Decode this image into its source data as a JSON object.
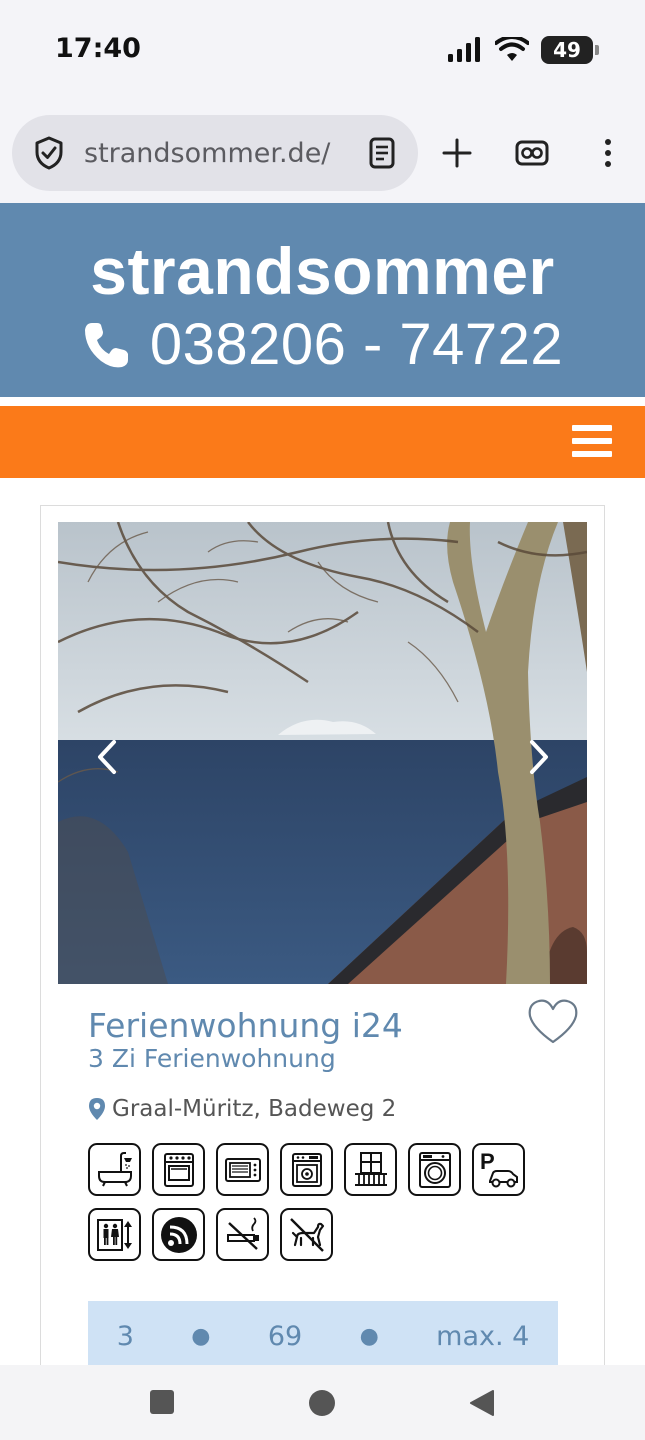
{
  "status_bar": {
    "time": "17:40",
    "battery": "49"
  },
  "browser": {
    "url": "strandsommer.de/"
  },
  "header": {
    "brand": "strandsommer",
    "phone": "038206 - 74722"
  },
  "listing": {
    "title": "Ferienwohnung i24",
    "subtitle": "3 Zi Ferienwohnung",
    "address": "Graal-Müritz, Badeweg 2",
    "amenities": [
      "bathtub-shower",
      "stove",
      "microwave",
      "dishwasher",
      "balcony",
      "washing-machine",
      "parking",
      "elevator",
      "wifi",
      "no-smoking",
      "no-pets"
    ],
    "facts": {
      "rooms": "3",
      "area": "69",
      "persons": "max. 4"
    }
  },
  "colors": {
    "header_blue": "#6089af",
    "nav_orange": "#fb7a19",
    "facts_bg": "#cfe2f5"
  }
}
